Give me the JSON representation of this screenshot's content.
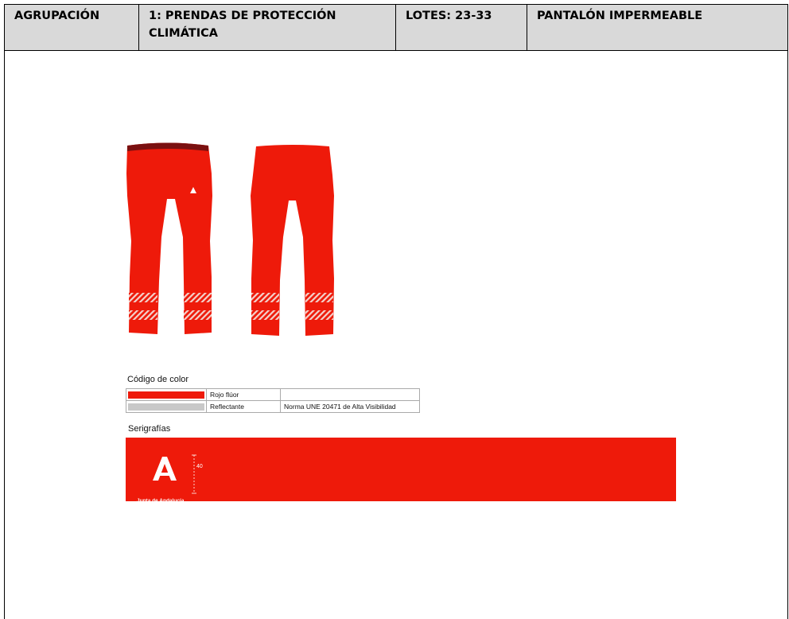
{
  "header": {
    "group_label": "AGRUPACIÓN",
    "group_value": "1: PRENDAS DE PROTECCIÓN CLIMÁTICA",
    "lots": "LOTES: 23-33",
    "product": "PANTALÓN IMPERMEABLE"
  },
  "colors": {
    "title": "Código de color",
    "rows": [
      {
        "swatch": "#ee1a0a",
        "name": "Rojo flúor",
        "note": ""
      },
      {
        "swatch": "#c8c8c8",
        "name": "Reflectante",
        "note": "Norma UNE 20471 de Alta Visibilidad"
      }
    ]
  },
  "serigraphy": {
    "title": "Serigrafías",
    "logo_caption": "Junta de Andalucía",
    "dimension": "40",
    "band_color": "#ee1a0a"
  }
}
